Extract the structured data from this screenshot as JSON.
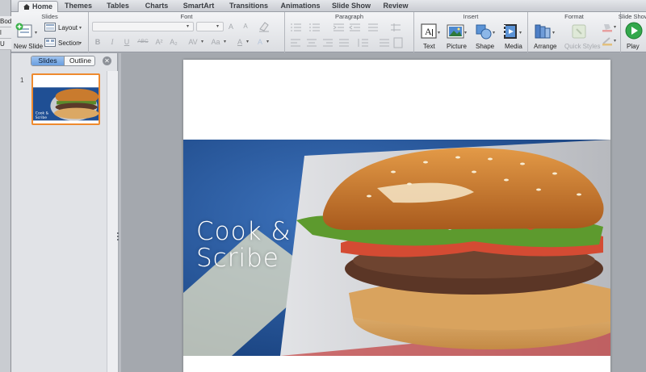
{
  "left_strip": {
    "cells": [
      "Bod",
      "l",
      "U"
    ]
  },
  "tabs": [
    {
      "label": "Home",
      "active": true
    },
    {
      "label": "Themes"
    },
    {
      "label": "Tables"
    },
    {
      "label": "Charts"
    },
    {
      "label": "SmartArt"
    },
    {
      "label": "Transitions"
    },
    {
      "label": "Animations"
    },
    {
      "label": "Slide Show"
    },
    {
      "label": "Review"
    }
  ],
  "ribbon": {
    "slides": {
      "title": "Slides",
      "new_slide": "New Slide",
      "layout": "Layout",
      "section": "Section"
    },
    "font": {
      "title": "Font",
      "bold": "B",
      "italic": "I",
      "underline": "U",
      "strike": "ABC",
      "superscript": "A²",
      "subscript": "A₂",
      "size_up": "A",
      "size_down": "A",
      "spacing": "AV",
      "change_case": "Aa",
      "color": "A",
      "highlight": "A"
    },
    "paragraph": {
      "title": "Paragraph"
    },
    "insert": {
      "title": "Insert",
      "text": "Text",
      "picture": "Picture",
      "shape": "Shape",
      "media": "Media"
    },
    "format": {
      "title": "Format",
      "arrange": "Arrange",
      "quick_styles": "Quick Styles"
    },
    "slide_show": {
      "title": "Slide Show",
      "play": "Play"
    }
  },
  "sidebar": {
    "tab_slides": "Slides",
    "tab_outline": "Outline",
    "close_glyph": "✕",
    "slide_number": "1",
    "thumb_caption": "Cook & Scribe"
  },
  "slide": {
    "caption_line1": "Cook &",
    "caption_line2": "Scribe"
  },
  "colors": {
    "accent_selection": "#ee8a2e",
    "segment_active": "#6a9fe0",
    "photo_background": "#1f4f94"
  }
}
